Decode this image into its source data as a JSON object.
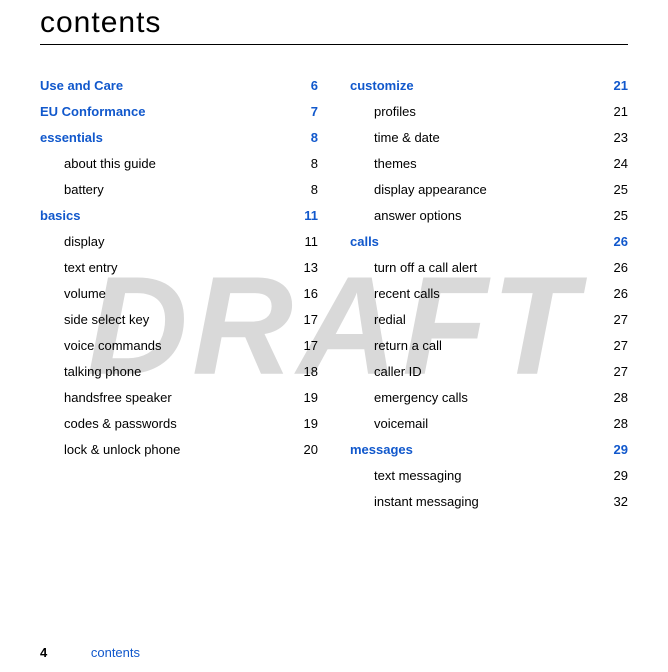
{
  "title": "contents",
  "watermark": "DRAFT",
  "footer": {
    "page_number": "4",
    "label": "contents"
  },
  "columns": {
    "left": [
      {
        "type": "section",
        "label": "Use and Care",
        "page": "6"
      },
      {
        "type": "section",
        "label": "EU Conformance",
        "page": "7"
      },
      {
        "type": "section",
        "label": "essentials",
        "page": "8"
      },
      {
        "type": "sub",
        "label": "about this guide",
        "page": "8"
      },
      {
        "type": "sub",
        "label": "battery",
        "page": "8"
      },
      {
        "type": "section",
        "label": "basics",
        "page": "11"
      },
      {
        "type": "sub",
        "label": "display",
        "page": "11"
      },
      {
        "type": "sub",
        "label": "text entry",
        "page": "13"
      },
      {
        "type": "sub",
        "label": "volume",
        "page": "16"
      },
      {
        "type": "sub",
        "label": "side select key",
        "page": "17"
      },
      {
        "type": "sub",
        "label": "voice commands",
        "page": "17"
      },
      {
        "type": "sub",
        "label": "talking phone",
        "page": "18"
      },
      {
        "type": "sub",
        "label": "handsfree speaker",
        "page": "19"
      },
      {
        "type": "sub",
        "label": "codes & passwords",
        "page": "19"
      },
      {
        "type": "sub",
        "label": "lock & unlock phone",
        "page": "20"
      }
    ],
    "right": [
      {
        "type": "section",
        "label": "customize",
        "page": "21"
      },
      {
        "type": "sub",
        "label": "profiles",
        "page": "21"
      },
      {
        "type": "sub",
        "label": "time & date",
        "page": "23"
      },
      {
        "type": "sub",
        "label": "themes",
        "page": "24"
      },
      {
        "type": "sub",
        "label": "display appearance",
        "page": "25"
      },
      {
        "type": "sub",
        "label": "answer options",
        "page": "25"
      },
      {
        "type": "section",
        "label": "calls",
        "page": "26"
      },
      {
        "type": "sub",
        "label": "turn off a call alert",
        "page": "26"
      },
      {
        "type": "sub",
        "label": "recent calls",
        "page": "26"
      },
      {
        "type": "sub",
        "label": "redial",
        "page": "27"
      },
      {
        "type": "sub",
        "label": "return a call",
        "page": "27"
      },
      {
        "type": "sub",
        "label": "caller ID",
        "page": "27"
      },
      {
        "type": "sub",
        "label": "emergency calls",
        "page": "28"
      },
      {
        "type": "sub",
        "label": "voicemail",
        "page": "28"
      },
      {
        "type": "section",
        "label": "messages",
        "page": "29"
      },
      {
        "type": "sub",
        "label": "text messaging",
        "page": "29"
      },
      {
        "type": "sub",
        "label": "instant messaging",
        "page": "32"
      }
    ]
  }
}
